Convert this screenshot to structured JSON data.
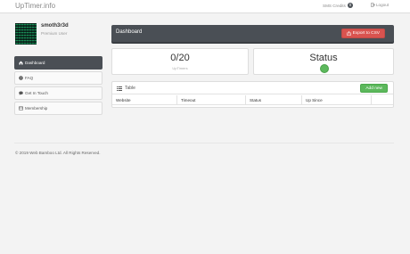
{
  "navbar": {
    "brand": "UpTimer.info",
    "sms_label": "SMS Credits",
    "sms_count": "0",
    "logout_label": "Logout"
  },
  "user": {
    "name": "smoth3r3d",
    "role": "Premium User"
  },
  "sidebar": {
    "items": [
      {
        "label": "Dashboard",
        "icon": "home-icon",
        "active": true
      },
      {
        "label": "FAQ",
        "icon": "question-icon",
        "active": false
      },
      {
        "label": "Get In Touch",
        "icon": "comment-icon",
        "active": false
      },
      {
        "label": "Membership",
        "icon": "card-icon",
        "active": false
      }
    ]
  },
  "header": {
    "title": "Dashboard",
    "export_label": "Export to CSV"
  },
  "stats": {
    "uptimers_value": "0/20",
    "uptimers_label": "UpTimers",
    "status_title": "Status",
    "status_color": "#5cb85c"
  },
  "table": {
    "title": "Table",
    "add_label": "Add new",
    "columns": [
      "Website",
      "Timeout",
      "Status",
      "Up Since",
      ""
    ]
  },
  "footer": {
    "text": "© 2019 Web Bamboo Ltd. All Rights Reserved."
  },
  "colors": {
    "dark": "#4a4f55",
    "danger": "#d9534f",
    "success": "#5cb85c"
  }
}
